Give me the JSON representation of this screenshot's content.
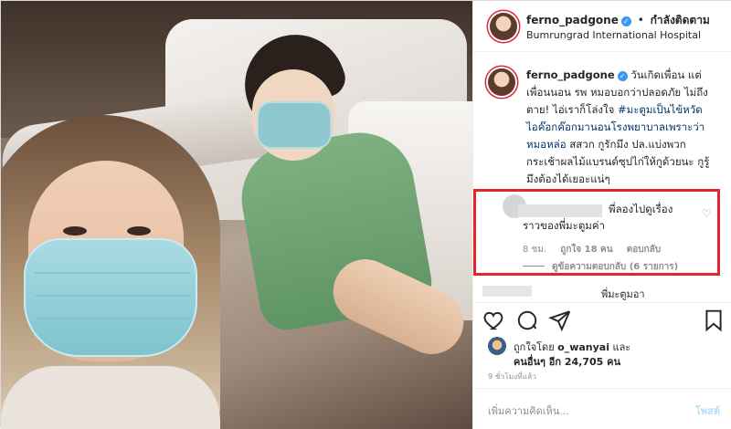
{
  "post": {
    "username": "ferno_padgone",
    "verified": true,
    "separator": "•",
    "follow_label": "กำลังติดตาม",
    "location": "Bumrungrad International Hospital"
  },
  "caption": {
    "username": "ferno_padgone",
    "text_before_hashtag": " วันเกิดเพื่อน แต่เพื่อนนอน รพ หมอบอกว่าปลอดภัย ไม่ถึงตาย! ไอ่เราก็โล่งใจ ",
    "hashtag": "#มะตูมเป็นไข้หวัดไอค๊อกค๊อกมานอนโรงพยาบาลเพราะว่าหมอหล่อ",
    "text_after_hashtag": " สสวก กูรักมึง ปล.แบ่งพวกกระเช้าผลไม้แบรนด์ซุปไก่ให้กูด้วยนะ กูรู้มึงต้องได้เยอะแน่ๆ"
  },
  "highlighted_comment": {
    "text_line1": "พี่ลองไปดูเรื่อง",
    "text_line2": "ราวของพี่มะตูมค่า",
    "time": "8 ชม.",
    "likes": "ถูกใจ 18 คน",
    "reply_label": "ตอบกลับ",
    "view_replies": "ดูข้อความตอบกลับ (6 รายการ)"
  },
  "next_comment": {
    "partial_text": "พี่มะตูมอา"
  },
  "actions": {
    "like_icon": "heart-icon",
    "comment_icon": "comment-icon",
    "share_icon": "share-icon",
    "save_icon": "bookmark-icon"
  },
  "likes": {
    "liked_by_prefix": "ถูกใจโดย ",
    "liked_by_user": "o_wanyai",
    "liked_by_suffix": " และ",
    "others_prefix": "คนอื่นๆ อีก ",
    "others_count": "24,705",
    "others_suffix": " คน"
  },
  "timestamp": "9 ชั่วโมงที่แล้ว",
  "add_comment": {
    "placeholder": "เพิ่มความคิดเห็น...",
    "post_label": "โพสต์"
  },
  "colors": {
    "highlight_border": "#e0262a",
    "verified": "#3897f0",
    "hashtag": "#00376b",
    "post_disabled": "#b2dffc"
  }
}
